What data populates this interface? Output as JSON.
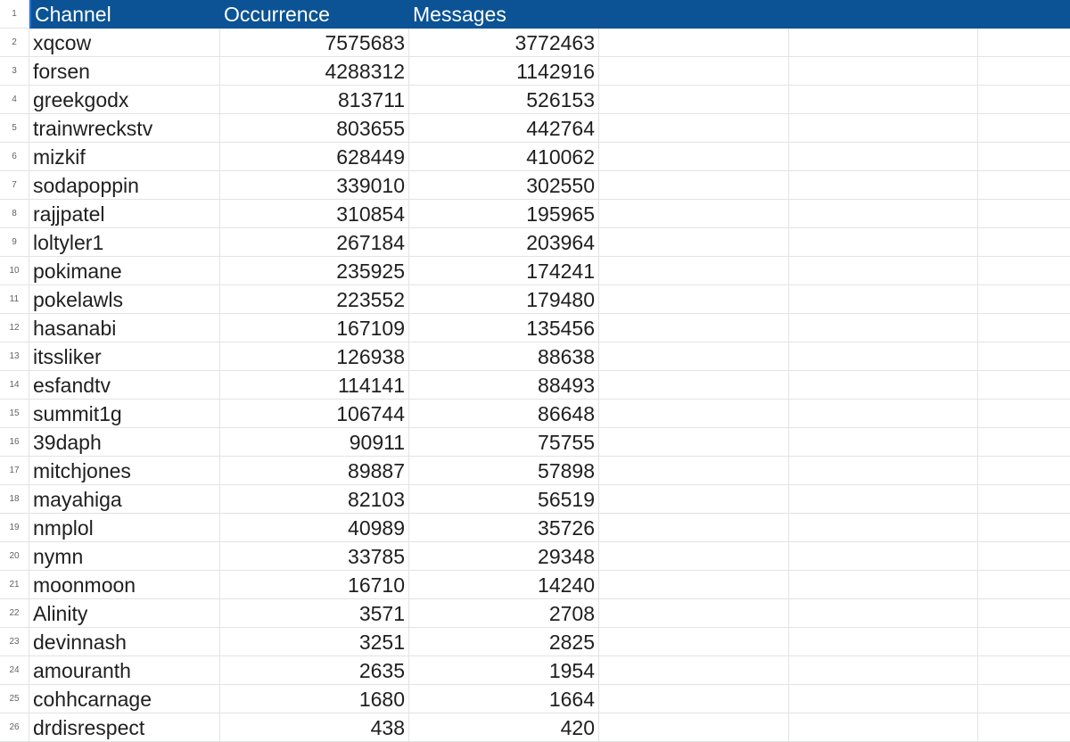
{
  "sheet": {
    "headers": {
      "channel": "Channel",
      "occurrence": "Occurrence",
      "messages": "Messages"
    },
    "header_color": "#0b5394",
    "rows": [
      {
        "num": "2",
        "channel": "xqcow",
        "occurrence": "7575683",
        "messages": "3772463"
      },
      {
        "num": "3",
        "channel": "forsen",
        "occurrence": "4288312",
        "messages": "1142916"
      },
      {
        "num": "4",
        "channel": "greekgodx",
        "occurrence": "813711",
        "messages": "526153"
      },
      {
        "num": "5",
        "channel": "trainwreckstv",
        "occurrence": "803655",
        "messages": "442764"
      },
      {
        "num": "6",
        "channel": "mizkif",
        "occurrence": "628449",
        "messages": "410062"
      },
      {
        "num": "7",
        "channel": "sodapoppin",
        "occurrence": "339010",
        "messages": "302550"
      },
      {
        "num": "8",
        "channel": "rajjpatel",
        "occurrence": "310854",
        "messages": "195965"
      },
      {
        "num": "9",
        "channel": "loltyler1",
        "occurrence": "267184",
        "messages": "203964"
      },
      {
        "num": "10",
        "channel": "pokimane",
        "occurrence": "235925",
        "messages": "174241"
      },
      {
        "num": "11",
        "channel": "pokelawls",
        "occurrence": "223552",
        "messages": "179480"
      },
      {
        "num": "12",
        "channel": "hasanabi",
        "occurrence": "167109",
        "messages": "135456"
      },
      {
        "num": "13",
        "channel": "itssliker",
        "occurrence": "126938",
        "messages": "88638"
      },
      {
        "num": "14",
        "channel": "esfandtv",
        "occurrence": "114141",
        "messages": "88493"
      },
      {
        "num": "15",
        "channel": "summit1g",
        "occurrence": "106744",
        "messages": "86648"
      },
      {
        "num": "16",
        "channel": "39daph",
        "occurrence": "90911",
        "messages": "75755"
      },
      {
        "num": "17",
        "channel": "mitchjones",
        "occurrence": "89887",
        "messages": "57898"
      },
      {
        "num": "18",
        "channel": "mayahiga",
        "occurrence": "82103",
        "messages": "56519"
      },
      {
        "num": "19",
        "channel": "nmplol",
        "occurrence": "40989",
        "messages": "35726"
      },
      {
        "num": "20",
        "channel": "nymn",
        "occurrence": "33785",
        "messages": "29348"
      },
      {
        "num": "21",
        "channel": "moonmoon",
        "occurrence": "16710",
        "messages": "14240"
      },
      {
        "num": "22",
        "channel": "Alinity",
        "occurrence": "3571",
        "messages": "2708"
      },
      {
        "num": "23",
        "channel": "devinnash",
        "occurrence": "3251",
        "messages": "2825"
      },
      {
        "num": "24",
        "channel": "amouranth",
        "occurrence": "2635",
        "messages": "1954"
      },
      {
        "num": "25",
        "channel": "cohhcarnage",
        "occurrence": "1680",
        "messages": "1664"
      },
      {
        "num": "26",
        "channel": "drdisrespect",
        "occurrence": "438",
        "messages": "420"
      }
    ]
  }
}
